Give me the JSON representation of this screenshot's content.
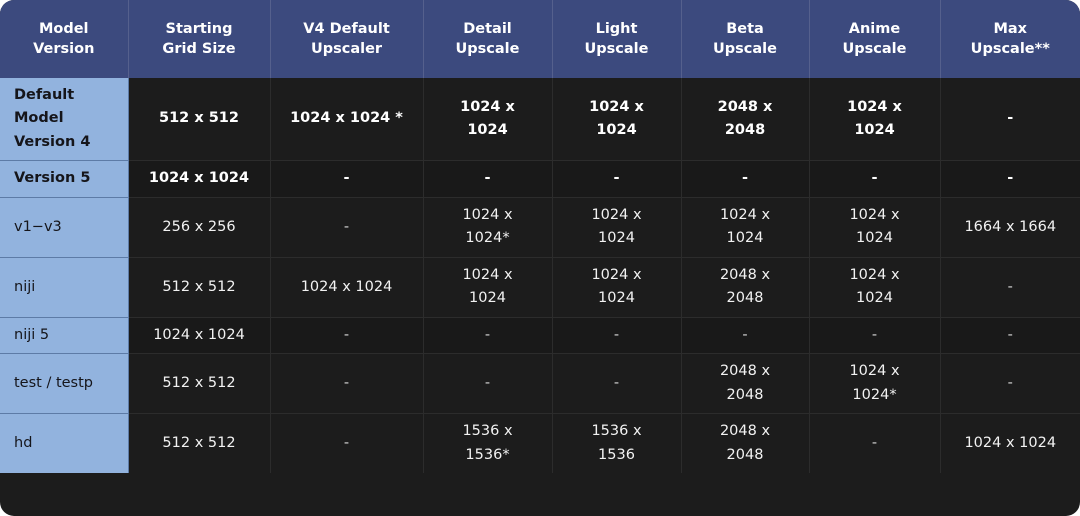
{
  "table": {
    "columns": [
      "Model\nVersion",
      "Starting\nGrid Size",
      "V4 Default\nUpscaler",
      "Detail\nUpscale",
      "Light\nUpscale",
      "Beta\nUpscale",
      "Anime\nUpscale",
      "Max\nUpscale**"
    ],
    "rows": [
      {
        "label": "Default\nModel\nVersion 4",
        "bold": true,
        "cells": [
          "512 x 512",
          "1024 x 1024 *",
          "1024 x\n1024",
          "1024 x\n1024",
          "2048 x\n2048",
          "1024 x\n1024",
          "-"
        ]
      },
      {
        "label": "Version 5",
        "bold": true,
        "cells": [
          "1024 x 1024",
          "-",
          "-",
          "-",
          "-",
          "-",
          "-"
        ]
      },
      {
        "label": "v1−v3",
        "bold": false,
        "cells": [
          "256 x 256",
          "-",
          "1024 x\n1024*",
          "1024 x\n1024",
          "1024 x\n1024",
          "1024 x\n1024",
          "1664 x 1664"
        ]
      },
      {
        "label": "niji",
        "bold": false,
        "cells": [
          "512 x 512",
          "1024 x 1024",
          "1024 x\n1024",
          "1024 x\n1024",
          "2048 x\n2048",
          "1024 x\n1024",
          "-"
        ]
      },
      {
        "label": "niji 5",
        "bold": false,
        "cells": [
          "1024 x 1024",
          "-",
          "-",
          "-",
          "-",
          "-",
          "-"
        ]
      },
      {
        "label": "test / testp",
        "bold": false,
        "cells": [
          "512 x 512",
          "-",
          "-",
          "-",
          "2048 x\n2048",
          "1024 x\n1024*",
          "-"
        ]
      },
      {
        "label": "hd",
        "bold": false,
        "cells": [
          "512 x 512",
          "-",
          "1536 x\n1536*",
          "1536 x\n1536",
          "2048 x\n2048",
          "-",
          "1024 x 1024"
        ]
      }
    ]
  },
  "colors": {
    "header_bg": "#3c4a7e",
    "rowlabel_bg": "#92b3de",
    "cell_bg": "#1c1c1c",
    "header_text": "#ffffff",
    "rowlabel_text": "#15151a",
    "cell_text": "#f2f2f2"
  }
}
